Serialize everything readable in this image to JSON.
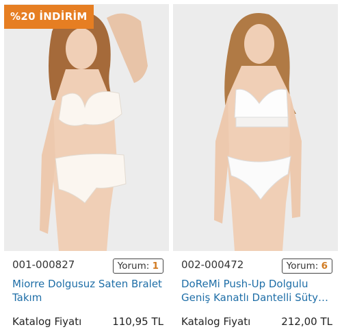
{
  "products": [
    {
      "badge": "%20 İNDİRİM",
      "code": "001-000827",
      "review_label": "Yorum:",
      "review_count": "1",
      "title_line1": "Miorre Dolgusuz Saten Bralet",
      "title_line2": "Takım",
      "price_label": "Katalog Fiyatı",
      "price": "110,95 TL"
    },
    {
      "code": "002-000472",
      "review_label": "Yorum:",
      "review_count": "6",
      "title_line1": "DoReMi Push-Up Dolgulu",
      "title_line2": "Geniş Kanatlı Dantelli Sütye…",
      "price_label": "Katalog Fiyatı",
      "price": "212,00 TL"
    }
  ],
  "colors": {
    "badge": "#e67e22",
    "link": "#1e6ea7",
    "review_count": "#d17a20"
  }
}
